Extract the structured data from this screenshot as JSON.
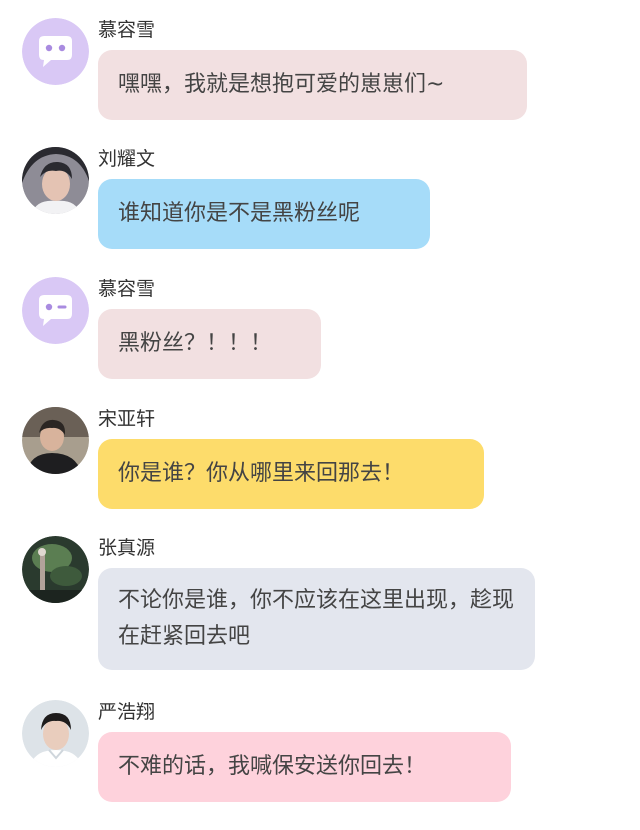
{
  "messages": [
    {
      "name": "慕容雪",
      "text": "嘿嘿，我就是想抱可爱的崽崽们~",
      "bubble_color": "#f2e0e1",
      "avatar_icon": "purple-chat-face-icon"
    },
    {
      "name": "刘耀文",
      "text": "谁知道你是不是黑粉丝呢",
      "bubble_color": "#a6dcf9",
      "avatar_icon": "profile-photo"
    },
    {
      "name": "慕容雪",
      "text": "黑粉丝？！！！",
      "bubble_color": "#f2e0e1",
      "avatar_icon": "purple-chat-face-icon"
    },
    {
      "name": "宋亚轩",
      "text": "你是谁？你从哪里来回那去！",
      "bubble_color": "#fddc6b",
      "avatar_icon": "profile-photo"
    },
    {
      "name": "张真源",
      "text": "不论你是谁，你不应该在这里出现，趁现在赶紧回去吧",
      "bubble_color": "#e3e6ee",
      "avatar_icon": "profile-photo"
    },
    {
      "name": "严浩翔",
      "text": "不难的话，我喊保安送你回去！",
      "bubble_color": "#fed2dc",
      "avatar_icon": "profile-photo"
    }
  ]
}
